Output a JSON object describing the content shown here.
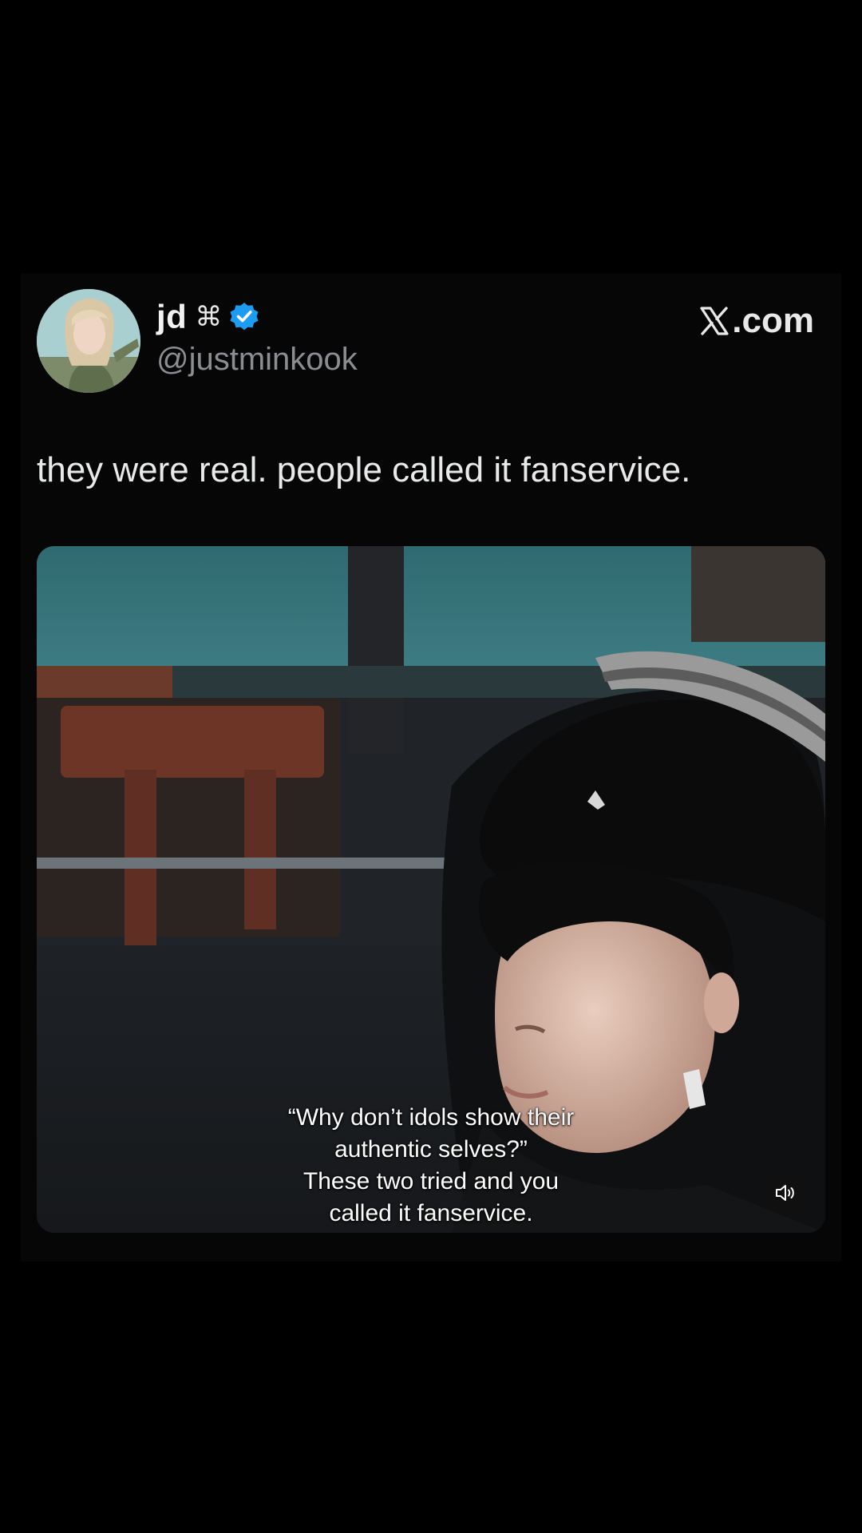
{
  "post": {
    "display_name": "jd",
    "name_symbol": "⌘",
    "handle": "@justminkook",
    "brand": ".com",
    "text": "they were real. people called it fanservice."
  },
  "media": {
    "subtitle_lines": [
      "“Why don’t idols show their",
      "authentic selves?”",
      "These two tried and you",
      "called it fanservice."
    ]
  },
  "icons": {
    "verified": "verified-badge-icon",
    "brand": "x-logo-icon",
    "sound": "speaker-icon"
  },
  "colors": {
    "background": "#000000",
    "card": "#060606",
    "verified": "#1d9bf0",
    "handle": "#8a8d91",
    "text": "#e7e9ea"
  }
}
